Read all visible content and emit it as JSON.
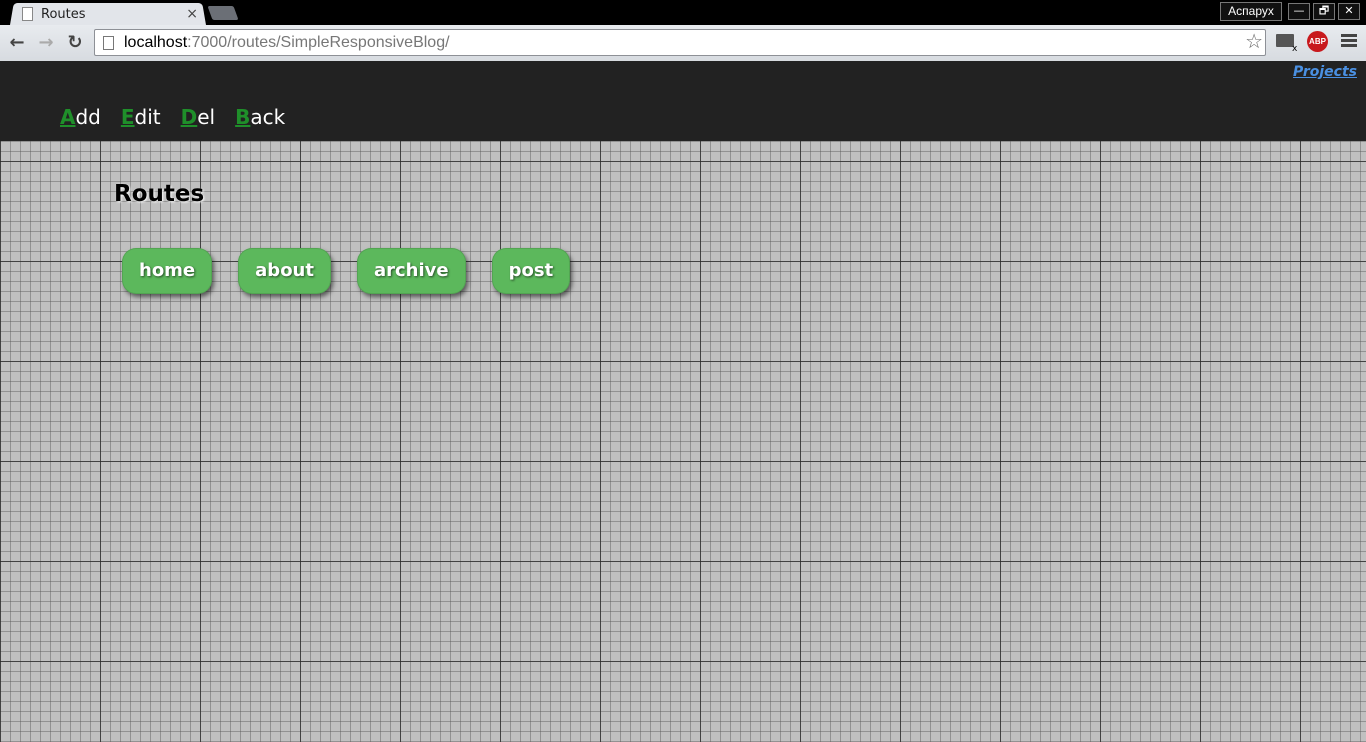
{
  "browser": {
    "tab_title": "Routes",
    "tab_close": "×",
    "profile_name": "Аспарух",
    "window_buttons": [
      "—",
      "🗗",
      "✕"
    ],
    "url_host": "localhost",
    "url_path": ":7000/routes/SimpleResponsiveBlog/",
    "nav": {
      "back": "←",
      "forward": "→",
      "reload": "↻"
    },
    "star": "☆",
    "extensions": {
      "mail_badge": "x",
      "abp": "ABP"
    }
  },
  "header": {
    "projects_link": "Projects",
    "actions": [
      {
        "key": "A",
        "rest": "dd"
      },
      {
        "key": "E",
        "rest": "dit"
      },
      {
        "key": "D",
        "rest": "el"
      },
      {
        "key": "B",
        "rest": "ack"
      }
    ]
  },
  "main": {
    "title": "Routes",
    "routes": [
      "home",
      "about",
      "archive",
      "post"
    ]
  },
  "colors": {
    "header_bg": "#222222",
    "accent_green": "#5cb85c",
    "hotkey_green": "#1f8f2a",
    "link_blue": "#4a90e2",
    "grid_bg": "#c0c0c0"
  }
}
